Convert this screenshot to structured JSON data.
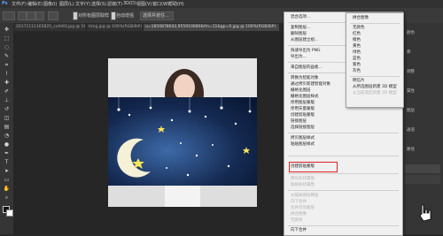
{
  "menubar": [
    "文件(F)",
    "编辑(E)",
    "图像(I)",
    "图层(L)",
    "文字(Y)",
    "选择(S)",
    "滤镜(T)",
    "3D(D)",
    "视图(V)",
    "窗口(W)",
    "帮助(H)"
  ],
  "options": {
    "sample_all_layers": "对所有图层取样",
    "auto_enhance": "自动增强",
    "select_subject": "选择并遮住..."
  },
  "tabs": [
    "20171111165825_cufe93.jpg @ 16.7%(RGB/8#)",
    "timg.jpg @ 100%(RGB/8#)",
    "u=1850878642,955910680&fm=11&gp=0.jpg @ 100%(RGB/8#)",
    "0.jpg @ 66.7%"
  ],
  "context_menu": {
    "items": [
      {
        "label": "混合选项...",
        "enabled": true
      },
      {
        "label": "复制图层...",
        "enabled": true
      },
      {
        "label": "删除图层",
        "enabled": true
      },
      {
        "label": "从图层建立组...",
        "enabled": true
      },
      {
        "label": "快速导出为 PNG",
        "enabled": true
      },
      {
        "label": "导出为...",
        "enabled": true
      },
      {
        "label": "来自图层的画板...",
        "enabled": true
      },
      {
        "label": "转换为智能对象",
        "enabled": true
      },
      {
        "label": "通过拷贝新建智能对象",
        "enabled": true
      },
      {
        "label": "栅格化图层",
        "enabled": true
      },
      {
        "label": "栅格化图层样式",
        "enabled": true
      },
      {
        "label": "停用图层蒙版",
        "enabled": true
      },
      {
        "label": "停用矢量蒙版",
        "enabled": true
      },
      {
        "label": "创建剪贴蒙版",
        "enabled": true
      },
      {
        "label": "链接图层",
        "enabled": true
      },
      {
        "label": "选择链接图层",
        "enabled": true
      },
      {
        "label": "拷贝图层样式",
        "enabled": true
      },
      {
        "label": "粘贴图层样式",
        "enabled": true
      },
      {
        "label": "创建剪贴蒙版",
        "enabled": true,
        "highlighted": true
      },
      {
        "label": "拷贝形状属性",
        "enabled": false
      },
      {
        "label": "粘贴形状属性",
        "enabled": false
      },
      {
        "label": "从隔离图层释放",
        "enabled": false
      },
      {
        "label": "向下合并",
        "enabled": false
      },
      {
        "label": "合并可见图层",
        "enabled": false
      },
      {
        "label": "拼合图像",
        "enabled": false
      },
      {
        "label": "无颜色",
        "enabled": false
      },
      {
        "label": "向下合并",
        "enabled": true
      }
    ]
  },
  "sub_menu": {
    "items": [
      {
        "label": "拼合图像",
        "enabled": true
      },
      {
        "label": "无颜色",
        "enabled": true
      },
      {
        "label": "红色",
        "enabled": true
      },
      {
        "label": "橙色",
        "enabled": true
      },
      {
        "label": "黄色",
        "enabled": true
      },
      {
        "label": "绿色",
        "enabled": true
      },
      {
        "label": "蓝色",
        "enabled": true
      },
      {
        "label": "紫色",
        "enabled": true
      },
      {
        "label": "灰色",
        "enabled": true
      },
      {
        "label": "明信片",
        "enabled": true
      },
      {
        "label": "从所选图层新建 3D 模型",
        "enabled": true
      },
      {
        "label": "从当前选区新建 3D 模型",
        "enabled": false
      }
    ]
  },
  "right_panel": {
    "labels": [
      "颜色",
      "库",
      "调整",
      "属性",
      "图层",
      "通道",
      "路径"
    ]
  },
  "colors": {
    "highlight_border": "#e02020",
    "menu_bg": "#f0f0f0",
    "app_bg": "#282828"
  }
}
